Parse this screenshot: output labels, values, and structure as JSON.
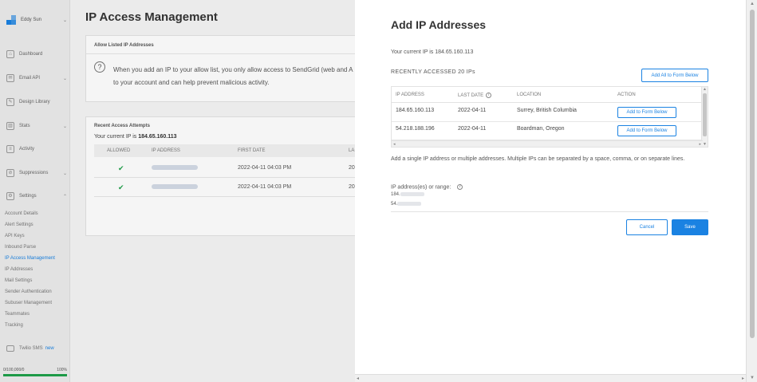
{
  "sidebar": {
    "account_name": "Eddy Sun",
    "nav": [
      {
        "label": "Dashboard",
        "icon": "dashboard-icon",
        "glyph": "⌂",
        "chevron": ""
      },
      {
        "label": "Email API",
        "icon": "email-api-icon",
        "glyph": "✉",
        "chevron": "⌄"
      },
      {
        "label": "Design Library",
        "icon": "design-library-icon",
        "glyph": "✎",
        "chevron": ""
      },
      {
        "label": "Stats",
        "icon": "stats-icon",
        "glyph": "▥",
        "chevron": "⌄"
      },
      {
        "label": "Activity",
        "icon": "activity-icon",
        "glyph": "≡",
        "chevron": ""
      },
      {
        "label": "Suppressions",
        "icon": "suppressions-icon",
        "glyph": "⊘",
        "chevron": "⌄"
      },
      {
        "label": "Settings",
        "icon": "settings-icon",
        "glyph": "⚙",
        "chevron": "⌃"
      }
    ],
    "settings_items": [
      "Account Details",
      "Alert Settings",
      "API Keys",
      "Inbound Parse",
      "IP Access Management",
      "IP Addresses",
      "Mail Settings",
      "Sender Authentication",
      "Subuser Management",
      "Teammates",
      "Tracking"
    ],
    "active_item": "IP Access Management",
    "promo_label": "Twilio SMS",
    "promo_badge": "new",
    "progress": {
      "left_label": "0/100,000/0",
      "right_label": "100%",
      "fraction": 1.0
    }
  },
  "main": {
    "title": "IP Access Management",
    "allow_card": {
      "title": "Allow Listed IP Addresses",
      "text_line1": "When you add an IP to your allow list, you only allow access to SendGrid (web and A",
      "text_line2": "to your account and can help prevent malicious activity."
    },
    "attempts_card": {
      "title": "Recent Access Attempts",
      "current_ip_label": "Your current IP is",
      "current_ip": "184.65.160.113",
      "columns": [
        "ALLOWED",
        "IP ADDRESS",
        "FIRST DATE",
        "LA"
      ],
      "rows": [
        {
          "first_date": "2022-04-11 04:03 PM",
          "last": "20"
        },
        {
          "first_date": "2022-04-11 04:03 PM",
          "last": "20"
        }
      ]
    }
  },
  "modal": {
    "title": "Add IP Addresses",
    "current_ip_text": "Your current IP is 184.65.160.113",
    "recent_title": "RECENTLY ACCESSED 20 IPs",
    "add_all_label": "Add All to Form Below",
    "columns": {
      "ip": "IP ADDRESS",
      "last_date": "LAST DATE",
      "location": "LOCATION",
      "action": "ACTION"
    },
    "rows": [
      {
        "ip": "184.65.160.113",
        "last_date": "2022-04-11",
        "location": "Surrey, British Columbia",
        "action": "Add to Form Below"
      },
      {
        "ip": "54.218.188.196",
        "last_date": "2022-04-11",
        "location": "Boardman, Oregon",
        "action": "Add to Form Below"
      }
    ],
    "help_text": "Add a single IP address or multiple addresses. Multiple IPs can be separated by a space, comma, or on separate lines.",
    "field_label": "IP address(es) or range:",
    "field_values": [
      "184.",
      "54."
    ],
    "cancel_label": "Cancel",
    "save_label": "Save"
  },
  "colors": {
    "accent": "#1a82e2",
    "success": "#1fa14a"
  }
}
